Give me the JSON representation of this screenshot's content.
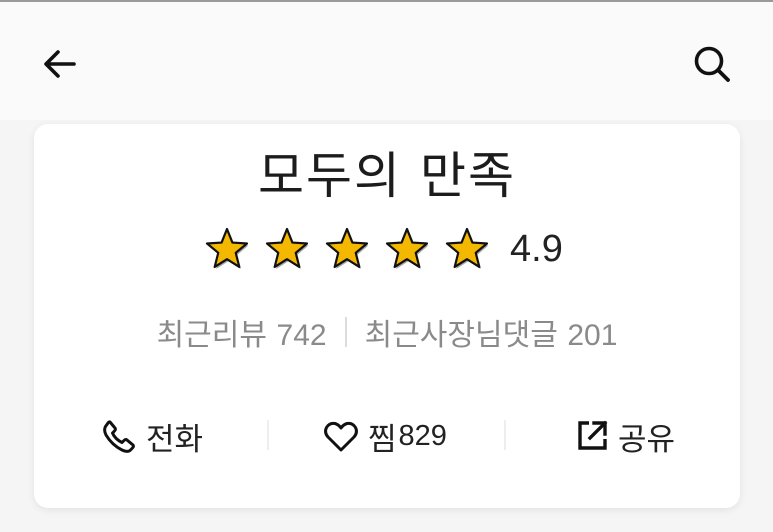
{
  "header": {
    "back_icon": "arrow-left-icon",
    "search_icon": "search-icon"
  },
  "store": {
    "name": "모두의 만족",
    "rating": {
      "stars_filled": 5,
      "stars_total": 5,
      "score": "4.9",
      "star_color": "#f5b800"
    }
  },
  "stats": {
    "reviews_label": "최근리뷰",
    "reviews_count": "742",
    "owner_replies_label": "최근사장님댓글",
    "owner_replies_count": "201"
  },
  "actions": {
    "call_label": "전화",
    "call_icon": "phone-icon",
    "like_label": "찜",
    "like_count": "829",
    "like_icon": "heart-icon",
    "share_label": "공유",
    "share_icon": "share-icon"
  }
}
